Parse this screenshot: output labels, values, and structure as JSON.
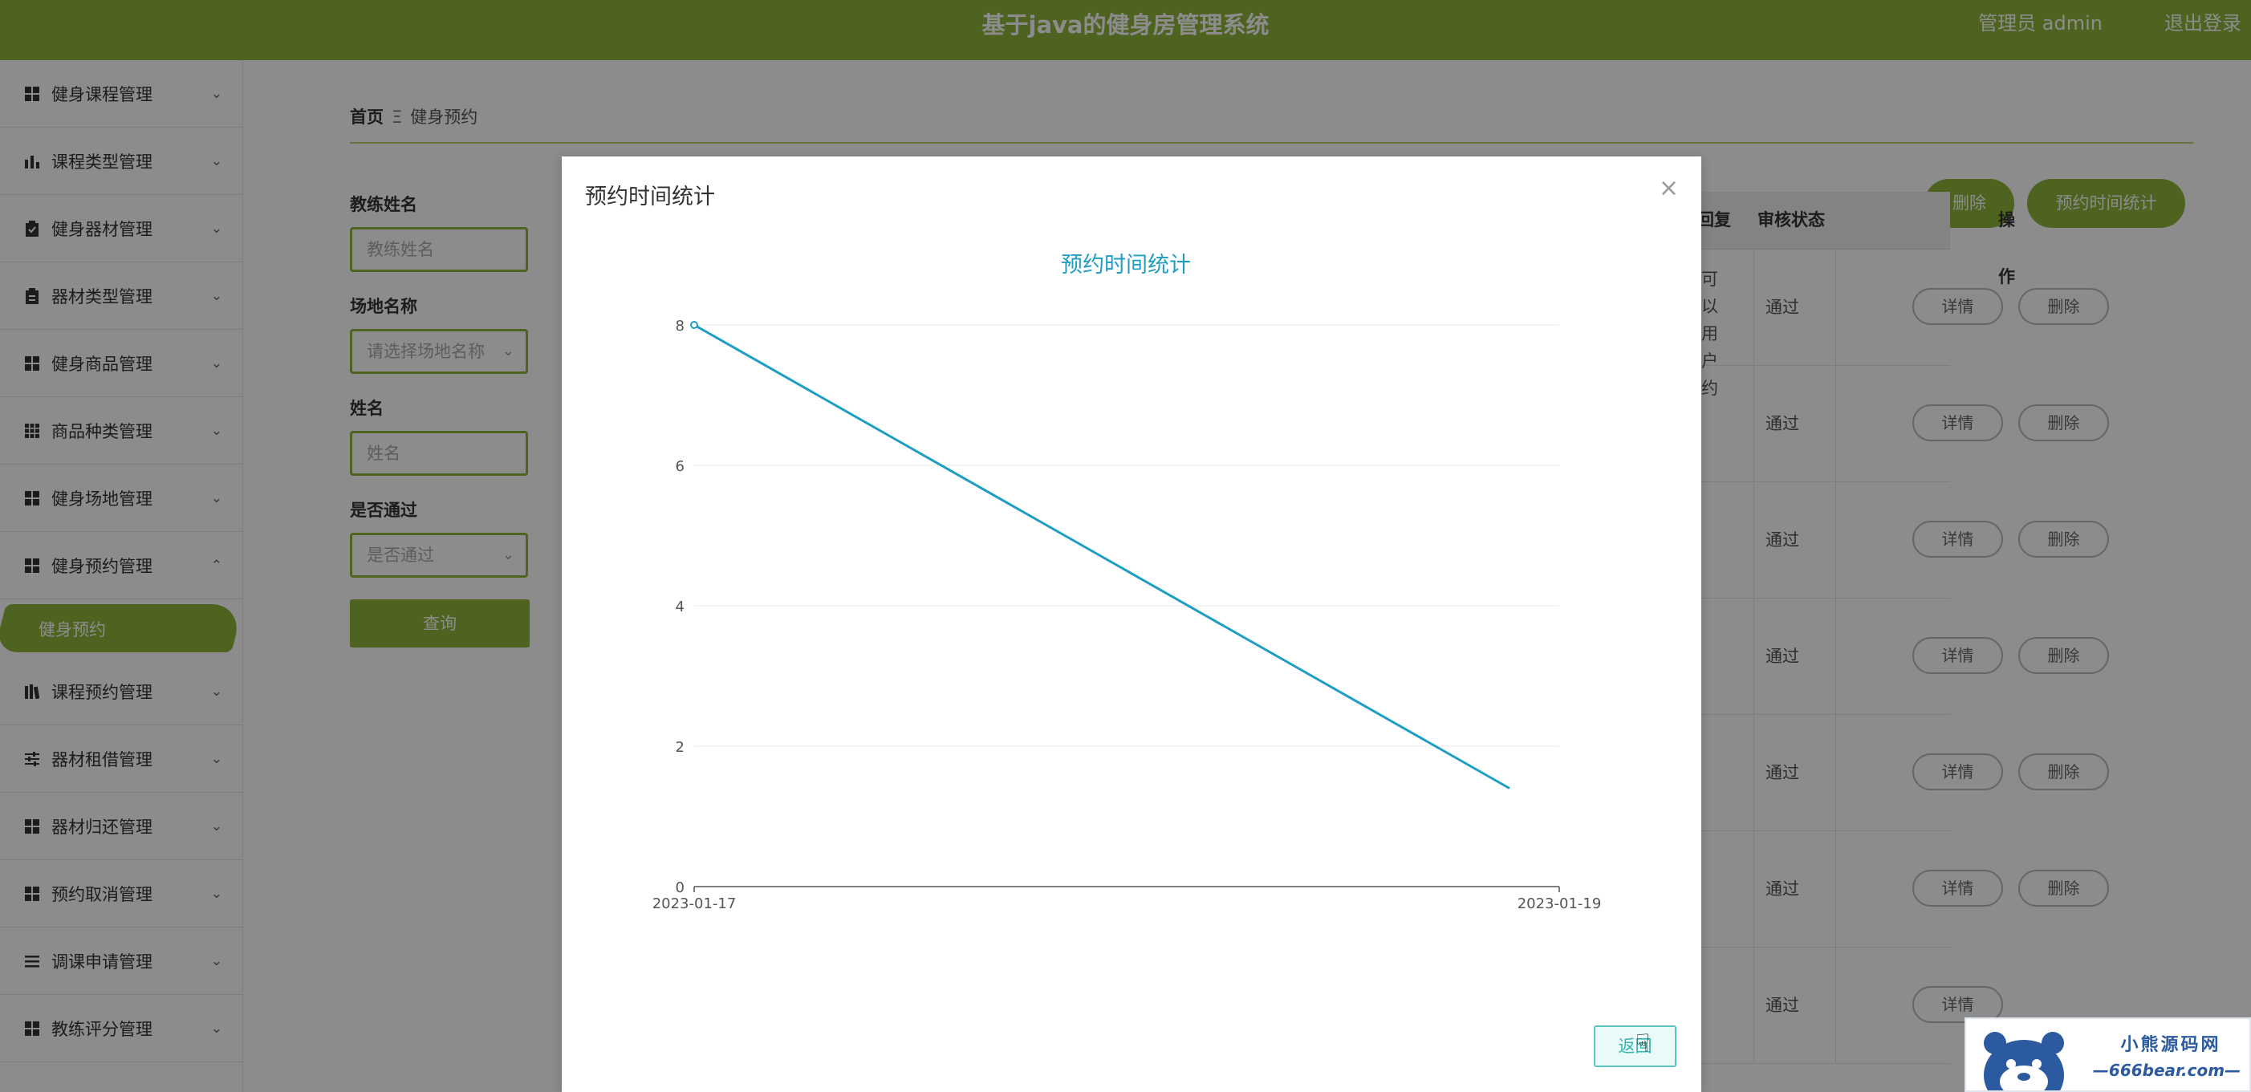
{
  "header": {
    "title": "基于java的健身房管理系统",
    "user": "管理员 admin",
    "logout": "退出登录"
  },
  "sidebar": {
    "items": [
      {
        "label": "健身课程管理",
        "icon": "grid-icon"
      },
      {
        "label": "课程类型管理",
        "icon": "bar-chart-icon"
      },
      {
        "label": "健身器材管理",
        "icon": "clipboard-check-icon"
      },
      {
        "label": "器材类型管理",
        "icon": "clipboard-list-icon"
      },
      {
        "label": "健身商品管理",
        "icon": "grid-icon"
      },
      {
        "label": "商品种类管理",
        "icon": "grid-nine-icon"
      },
      {
        "label": "健身场地管理",
        "icon": "grid-icon"
      },
      {
        "label": "健身预约管理",
        "icon": "grid-icon",
        "expanded": true
      },
      {
        "label": "课程预约管理",
        "icon": "books-icon"
      },
      {
        "label": "器材租借管理",
        "icon": "sliders-icon"
      },
      {
        "label": "器材归还管理",
        "icon": "grid-icon"
      },
      {
        "label": "预约取消管理",
        "icon": "grid-icon"
      },
      {
        "label": "调课申请管理",
        "icon": "list-icon"
      },
      {
        "label": "教练评分管理",
        "icon": "grid-icon"
      }
    ],
    "active_sub": "健身预约"
  },
  "breadcrumb": {
    "home": "首页",
    "sep": "Ξ",
    "current": "健身预约"
  },
  "filters": {
    "coach_label": "教练姓名",
    "coach_placeholder": "教练姓名",
    "venue_label": "场地名称",
    "venue_placeholder": "请选择场地名称",
    "name_label": "姓名",
    "name_placeholder": "姓名",
    "pass_label": "是否通过",
    "pass_placeholder": "是否通过",
    "query": "查询"
  },
  "toolbar": {
    "delete": "删除",
    "stats": "预约时间统计"
  },
  "table": {
    "headers": {
      "reply": "回复",
      "status": "审核状态",
      "ops": "操作"
    },
    "first_row_fragment": [
      "可以",
      "用户",
      "约"
    ],
    "rows": [
      {
        "status": "通过"
      },
      {
        "status": "通过"
      },
      {
        "status": "通过"
      },
      {
        "status": "通过"
      },
      {
        "status": "通过"
      },
      {
        "status": "通过"
      },
      {
        "status": "通过"
      }
    ],
    "detail": "详情",
    "remove": "删除"
  },
  "dialog": {
    "title": "预约时间统计",
    "back": "返回",
    "close": "×"
  },
  "chart_data": {
    "type": "line",
    "title": "预约时间统计",
    "categories": [
      "2023-01-17",
      "2023-01-19"
    ],
    "series": [
      {
        "values": [
          8,
          1.4
        ]
      }
    ],
    "ylim": [
      0,
      8
    ],
    "yticks": [
      0,
      2,
      4,
      6,
      8
    ],
    "grid": true,
    "color": "#1f9ec4"
  },
  "watermark": {
    "name": "小熊源码网",
    "url": "—666bear.com—"
  },
  "colors": {
    "brand": "#8cb43a",
    "accent": "#1f9ec4"
  }
}
